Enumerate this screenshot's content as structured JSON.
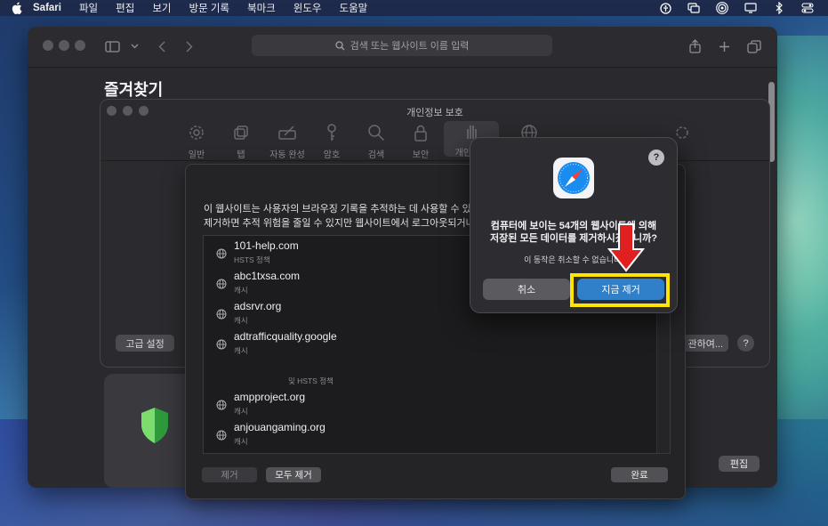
{
  "menubar": {
    "app_name": "Safari",
    "items": [
      "파일",
      "편집",
      "보기",
      "방문 기록",
      "북마크",
      "윈도우",
      "도움말"
    ]
  },
  "safari": {
    "address_placeholder": "검색 또는 웹사이트 이름 입력",
    "favorites_title": "즐겨찾기",
    "edit_label": "편집"
  },
  "settings": {
    "title": "개인정보 보호",
    "tabs": [
      {
        "label": "일반",
        "icon": "gear-icon"
      },
      {
        "label": "탭",
        "icon": "tabs-icon"
      },
      {
        "label": "자동 완성",
        "icon": "pencil-field-icon"
      },
      {
        "label": "암호",
        "icon": "key-icon"
      },
      {
        "label": "검색",
        "icon": "search-icon"
      },
      {
        "label": "보안",
        "icon": "lock-icon"
      },
      {
        "label": "개인정보",
        "icon": "hand-icon"
      }
    ],
    "advanced_label": "고급 설정",
    "manage_label": "관하여..."
  },
  "website_data": {
    "description_line1": "이 웹사이트는 사용자의 브라우징 기록을 추적하는 데 사용할 수 있",
    "description_line2": "제거하면 추적 위험을 줄일 수 있지만 웹사이트에서 로그아웃되거나",
    "rows": [
      {
        "domain": "101-help.com",
        "detail": "HSTS 정책"
      },
      {
        "domain": "abc1txsa.com",
        "detail": "캐시"
      },
      {
        "domain": "adsrvr.org",
        "detail": "캐시"
      },
      {
        "domain": "adtrafficquality.google",
        "detail": "캐시"
      },
      {
        "domain": "ampproject.org",
        "detail": "캐시"
      },
      {
        "domain": "anjouangaming.org",
        "detail": "캐시"
      }
    ],
    "faded_detail": "및 HSTS 정책",
    "remove_label": "제거",
    "remove_all_label": "모두 제거",
    "done_label": "완료"
  },
  "alert": {
    "message": "컴퓨터에 보이는 54개의 웹사이트에 의해 저장된 모든 데이터를 제거하시겠습니까?",
    "message_line1": "컴퓨터에 보이는 54개의 웹사이트에 의해",
    "message_line2": "저장된 모든 데이터를 제거하시겠습니까?",
    "info": "이 동작은 취소할 수 없습니다.",
    "cancel_label": "취소",
    "confirm_label": "지금 제거",
    "help_label": "?"
  },
  "colors": {
    "accent_blue": "#2f7fc9",
    "highlight_yellow": "#ffe600",
    "arrow_red": "#e02020"
  }
}
